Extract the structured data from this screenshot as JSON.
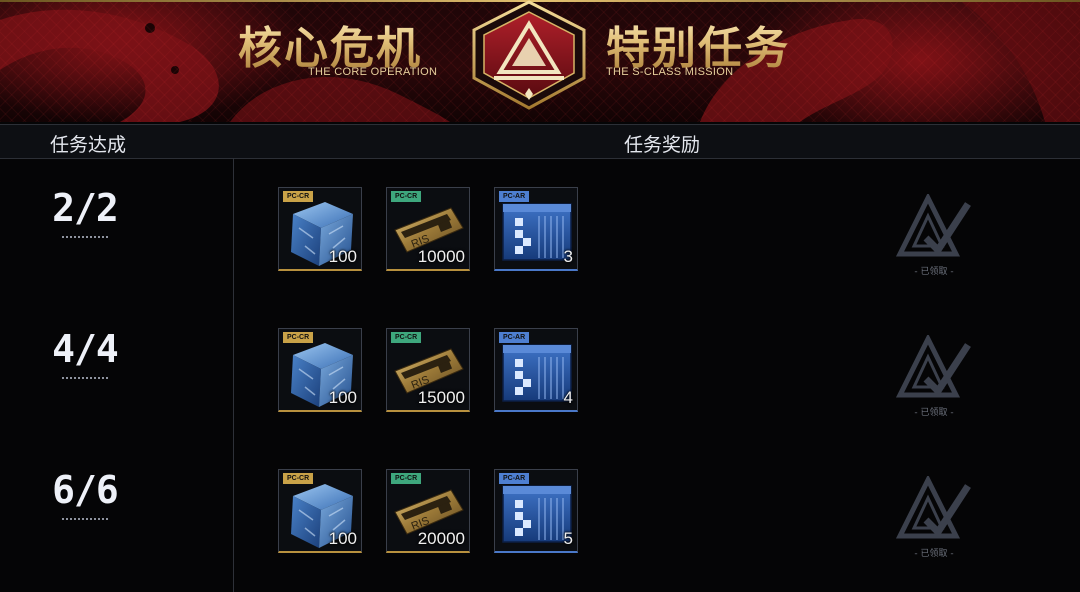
{
  "banner": {
    "title_left": "核心危机",
    "subtitle_left": "THE CORE OPERATION",
    "title_right": "特别任务",
    "subtitle_right": "THE S-CLASS MISSION"
  },
  "headers": {
    "progress": "任务达成",
    "rewards": "任务奖励"
  },
  "colors": {
    "gold": "#c9a248",
    "green": "#3ea77d",
    "blue": "#4e7fd1",
    "banner_red": "#8a1418"
  },
  "rows": [
    {
      "progress": "2/2",
      "rewards": [
        {
          "tag": "PC-CR",
          "quantity": "100",
          "icon": "crystal-cube-icon"
        },
        {
          "tag": "PC-CR",
          "quantity": "10000",
          "icon": "credit-card-icon"
        },
        {
          "tag": "PC-AR",
          "quantity": "3",
          "icon": "supply-crate-icon"
        }
      ],
      "status": "- 已领取 -"
    },
    {
      "progress": "4/4",
      "rewards": [
        {
          "tag": "PC-CR",
          "quantity": "100",
          "icon": "crystal-cube-icon"
        },
        {
          "tag": "PC-CR",
          "quantity": "15000",
          "icon": "credit-card-icon"
        },
        {
          "tag": "PC-AR",
          "quantity": "4",
          "icon": "supply-crate-icon"
        }
      ],
      "status": "- 已领取 -"
    },
    {
      "progress": "6/6",
      "rewards": [
        {
          "tag": "PC-CR",
          "quantity": "100",
          "icon": "crystal-cube-icon"
        },
        {
          "tag": "PC-CR",
          "quantity": "20000",
          "icon": "credit-card-icon"
        },
        {
          "tag": "PC-AR",
          "quantity": "5",
          "icon": "supply-crate-icon"
        }
      ],
      "status": "- 已领取 -"
    }
  ]
}
